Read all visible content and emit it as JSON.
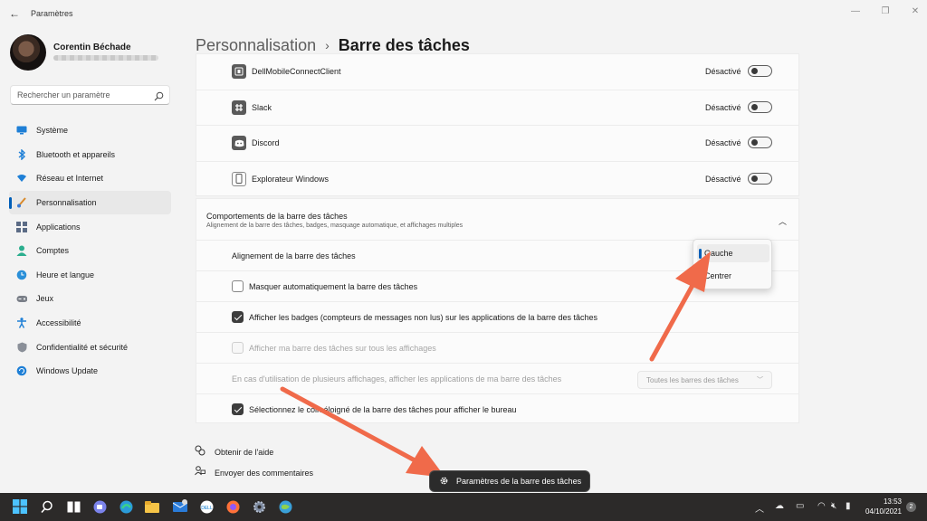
{
  "window": {
    "title": "Paramètres"
  },
  "user": {
    "name": "Corentin Béchade"
  },
  "search": {
    "placeholder": "Rechercher un paramètre"
  },
  "sidebar": {
    "items": [
      {
        "label": "Système",
        "icon": "system-icon"
      },
      {
        "label": "Bluetooth et appareils",
        "icon": "bluetooth-icon"
      },
      {
        "label": "Réseau et Internet",
        "icon": "network-icon"
      },
      {
        "label": "Personnalisation",
        "icon": "brush-icon",
        "active": true
      },
      {
        "label": "Applications",
        "icon": "apps-icon"
      },
      {
        "label": "Comptes",
        "icon": "account-icon"
      },
      {
        "label": "Heure et langue",
        "icon": "globe-clock-icon"
      },
      {
        "label": "Jeux",
        "icon": "gamepad-icon"
      },
      {
        "label": "Accessibilité",
        "icon": "accessibility-icon"
      },
      {
        "label": "Confidentialité et sécurité",
        "icon": "shield-icon"
      },
      {
        "label": "Windows Update",
        "icon": "update-icon"
      }
    ]
  },
  "breadcrumb": {
    "parent": "Personnalisation",
    "separator": "›",
    "current": "Barre des tâches"
  },
  "tray_apps": {
    "rows": [
      {
        "name": "DellMobileConnectClient",
        "state": "Désactivé",
        "icon": "dell-mobile-icon"
      },
      {
        "name": "Slack",
        "state": "Désactivé",
        "icon": "slack-icon"
      },
      {
        "name": "Discord",
        "state": "Désactivé",
        "icon": "discord-icon"
      },
      {
        "name": "Explorateur Windows",
        "state": "Désactivé",
        "icon": "explorer-icon"
      }
    ]
  },
  "behaviors": {
    "title": "Comportements de la barre des tâches",
    "subtitle": "Alignement de la barre des tâches, badges, masquage automatique, et affichages multiples",
    "alignment_label": "Alignement de la barre des tâches",
    "alignment_options": [
      "Gauche",
      "Centrer"
    ],
    "alignment_selected": "Gauche",
    "autohide_label": "Masquer automatiquement la barre des tâches",
    "badges_label": "Afficher les badges (compteurs de messages non lus) sur les applications de la barre des tâches",
    "all_displays_label": "Afficher ma barre des tâches sur tous les affichages",
    "multi_display_label": "En cas d'utilisation de plusieurs affichages, afficher les applications de ma barre des tâches",
    "multi_display_value": "Toutes les barres des tâches",
    "far_corner_label": "Sélectionnez le coin éloigné de la barre des tâches pour afficher le bureau"
  },
  "footer": {
    "help": "Obtenir de l'aide",
    "feedback": "Envoyer des commentaires"
  },
  "tooltip": {
    "text": "Paramètres de la barre des tâches"
  },
  "taskbar": {
    "time": "13:53",
    "date": "04/10/2021",
    "notification_count": "2",
    "mail_badge": "1"
  },
  "colors": {
    "accent": "#005fb8",
    "arrow": "#f06a4a",
    "taskbar": "#2c2a29"
  }
}
